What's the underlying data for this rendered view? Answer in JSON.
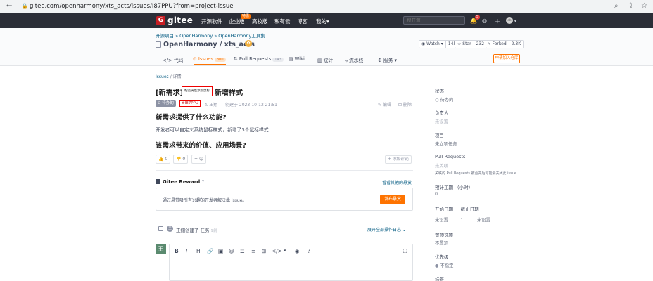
{
  "browser": {
    "url": "gitee.com/openharmony/xts_acts/issues/I87PPU?from=project-issue"
  },
  "nav": {
    "logo_letter": "G",
    "logo_text": "gitee",
    "items": [
      "开源软件",
      "企业版",
      "高校版",
      "私有云",
      "博客",
      "我的"
    ],
    "badge": "特惠",
    "my_suffix": "▾",
    "search_placeholder": "搜开源",
    "notif_count": "5",
    "avatar": "王"
  },
  "repo": {
    "breadcrumb": "开源项目 » OpenHarmony » OpenHarmony工具集",
    "title": "OpenHarmony / xts_acts",
    "watch_label": "◉ Watch ▾",
    "watch_count": "145",
    "star_label": "☆ Star",
    "star_count": "232",
    "fork_label": "⑂ Forked",
    "fork_count": "2.3K",
    "tabs": [
      {
        "label": "</> 代码",
        "count": ""
      },
      {
        "label": "⊙ Issues",
        "count": "300"
      },
      {
        "label": "⇅ Pull Requests",
        "count": "143"
      },
      {
        "label": "▤ Wiki",
        "count": ""
      },
      {
        "label": "▥ 统计",
        "count": ""
      },
      {
        "label": "⤷ 流水线",
        "count": ""
      },
      {
        "label": "✣ 服务 ▾",
        "count": ""
      }
    ],
    "join_button": "申请加入仓库"
  },
  "issue": {
    "crumb_parent": "Issues",
    "crumb_current": " / 详情",
    "title_prefix": "[新需求]：",
    "title_redacted": "构造属性添加鼠标",
    "title_suffix": "新增样式",
    "status": "⊙ 待办的",
    "id": "#I87PPU",
    "author": "♙ 王翔",
    "created": "创建于 2023-10-12 21:51",
    "edit": "✎ 编辑",
    "delete": "⊡ 删除",
    "h_what": "新需求提供了什么功能?",
    "description": "开发者可以自定义系统鼠标样式，新增了3个鼠标样式",
    "h_value": "该需求带来的价值、应用场景?",
    "thumbs_up": "👍 0",
    "thumbs_down": "👎 0",
    "add_reaction": "+ ☺",
    "add_comment": "+ 添加评论"
  },
  "reward": {
    "title": "Gitee Reward",
    "help": "?",
    "link": "看看其他的悬赏",
    "text": "通过悬赏吸引有兴趣的开发者解决此 Issue。",
    "button": "发布悬赏"
  },
  "timeline": {
    "avatar": "王",
    "text": "王翔创建了 任务",
    "time": "9前",
    "expand": "展开全部操作日志 ⌄"
  },
  "comment": {
    "avatar": "王",
    "toolbar": [
      "B",
      "I",
      "H",
      "🔗",
      "▣",
      "☺",
      "☰",
      "≡",
      "⊞",
      "</>",
      "❝",
      "◉",
      "?"
    ],
    "fullscreen": "⛶"
  },
  "sidebar": {
    "status_label": "状态",
    "status_value": "待办的",
    "assignee_label": "负责人",
    "assignee_value": "未设置",
    "project_label": "项目",
    "project_value": "未立项任务",
    "pr_label": "Pull Requests",
    "pr_value": "未关联",
    "pr_note": "关联的 Pull Requests 被合并后可能会关闭此 issue",
    "estimate_label": "预计工期 （小时）",
    "estimate_value": "0",
    "dates_label": "开始日期  －  截止日期",
    "start_value": "未设置",
    "dash": "-",
    "end_value": "未设置",
    "pin_label": "置顶选项",
    "pin_value": "不置顶",
    "priority_label": "优先级",
    "priority_value": "不指定",
    "tags_label": "标签"
  }
}
